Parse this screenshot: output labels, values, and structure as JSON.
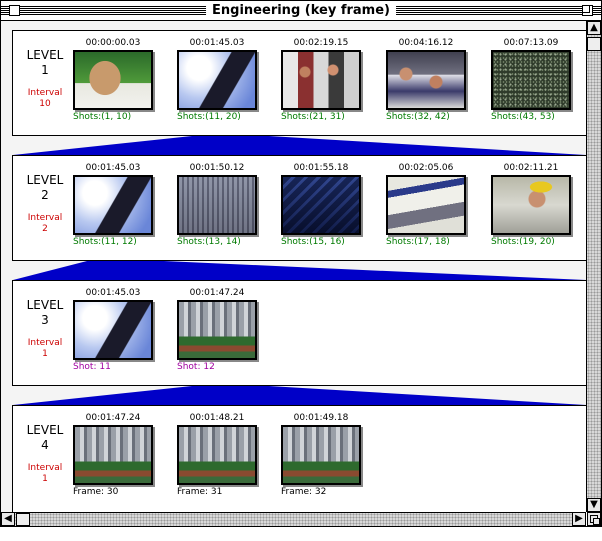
{
  "window": {
    "title": "Engineering (key frame)"
  },
  "colors": {
    "wedge": "#0000c8",
    "interval_text": "#cc0000",
    "shots_text": "#007a00",
    "single_shot_text": "#a000a0",
    "frame_text": "#000000"
  },
  "levels": [
    {
      "label": "LEVEL",
      "number": "1",
      "interval_label": "Interval",
      "interval_value": "10",
      "items": [
        {
          "time": "00:00:00.03",
          "caption": "Shots:(1, 10)",
          "image": "man-portrait"
        },
        {
          "time": "00:01:45.03",
          "caption": "Shots:(11, 20)",
          "image": "building-sky"
        },
        {
          "time": "00:02:19.15",
          "caption": "Shots:(21, 31)",
          "image": "people-indoor"
        },
        {
          "time": "00:04:16.12",
          "caption": "Shots:(32, 42)",
          "image": "people-group"
        },
        {
          "time": "00:07:13.09",
          "caption": "Shots:(43, 53)",
          "image": "dark-texture"
        }
      ]
    },
    {
      "label": "LEVEL",
      "number": "2",
      "interval_label": "Interval",
      "interval_value": "2",
      "items": [
        {
          "time": "00:01:45.03",
          "caption": "Shots:(11, 12)",
          "image": "building-sky"
        },
        {
          "time": "00:01:50.12",
          "caption": "Shots:(13, 14)",
          "image": "tall-buildings"
        },
        {
          "time": "00:01:55.18",
          "caption": "Shots:(15, 16)",
          "image": "glass-building"
        },
        {
          "time": "00:02:05.06",
          "caption": "Shots:(17, 18)",
          "image": "newspaper"
        },
        {
          "time": "00:02:11.21",
          "caption": "Shots:(19, 20)",
          "image": "worker-helmet"
        }
      ]
    },
    {
      "label": "LEVEL",
      "number": "3",
      "interval_label": "Interval",
      "interval_value": "1",
      "items": [
        {
          "time": "00:01:45.03",
          "caption": "Shot: 11",
          "image": "building-sky"
        },
        {
          "time": "00:01:47.24",
          "caption": "Shot: 12",
          "image": "city-skyline"
        }
      ]
    },
    {
      "label": "LEVEL",
      "number": "4",
      "interval_label": "Interval",
      "interval_value": "1",
      "items": [
        {
          "time": "00:01:47.24",
          "caption": "Frame: 30",
          "image": "city-skyline"
        },
        {
          "time": "00:01:48.21",
          "caption": "Frame: 31",
          "image": "city-skyline"
        },
        {
          "time": "00:01:49.18",
          "caption": "Frame: 32",
          "image": "city-skyline"
        }
      ]
    }
  ]
}
